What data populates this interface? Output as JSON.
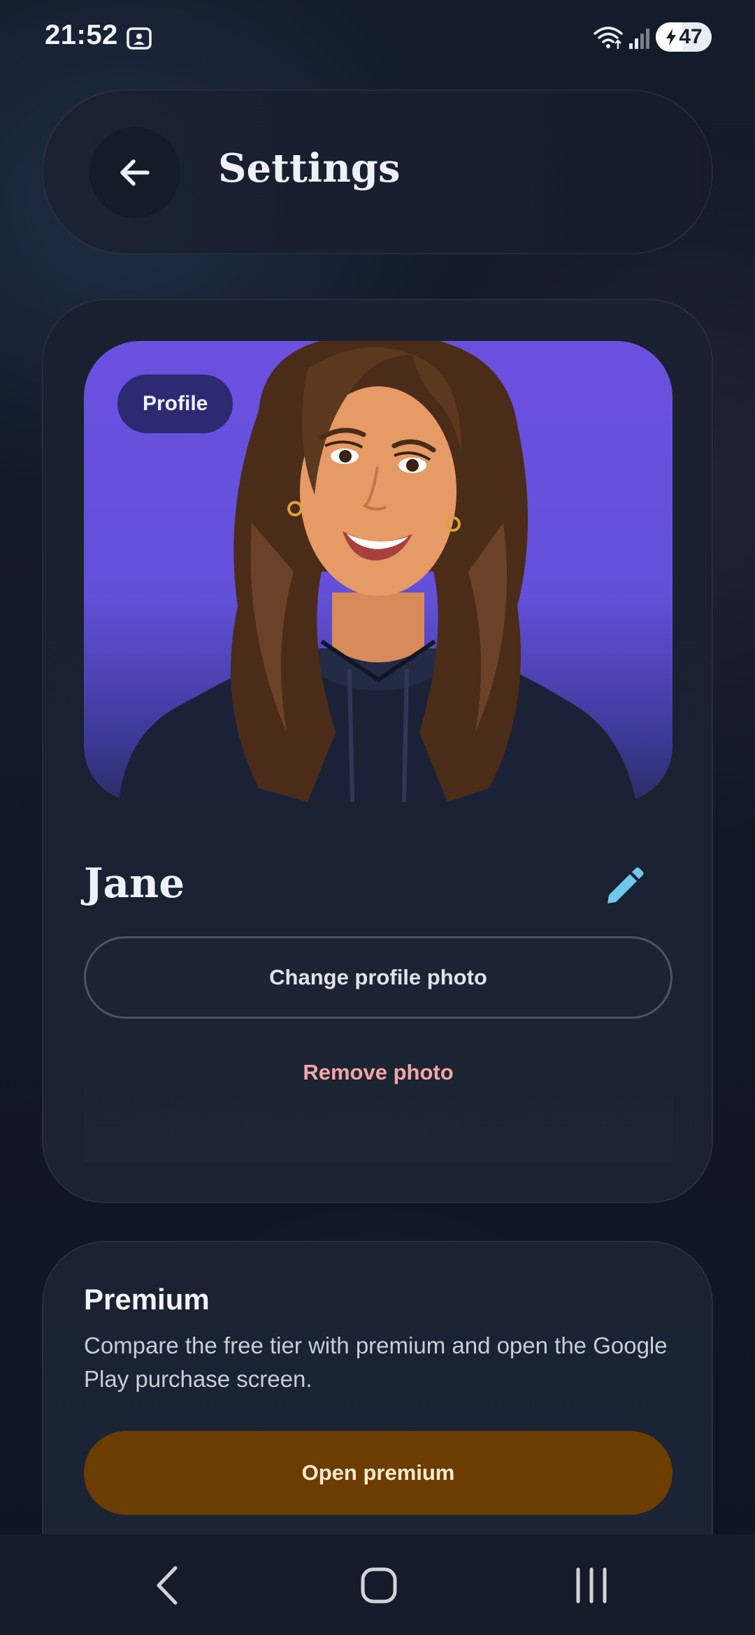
{
  "status_bar": {
    "time": "21:52",
    "battery_level": "47",
    "battery_fraction": 0.47,
    "icons": [
      "screenshot-icon",
      "wifi-icon",
      "signal-icon",
      "battery-charging-icon"
    ]
  },
  "header": {
    "title": "Settings",
    "back_icon": "arrow-left-icon"
  },
  "profile": {
    "chip_label": "Profile",
    "name": "Jane",
    "edit_icon": "pencil-icon",
    "change_photo_label": "Change profile photo",
    "remove_photo_label": "Remove photo"
  },
  "premium": {
    "title": "Premium",
    "description": "Compare the free tier with premium and open the Google Play purchase screen.",
    "button_label": "Open premium"
  },
  "nav": {
    "icons": [
      "nav-back-icon",
      "nav-home-icon",
      "nav-recents-icon"
    ]
  },
  "colors": {
    "background": "#111827",
    "card": "#19202f",
    "accent_blue": "#6fc8ea",
    "danger_text": "#f2a8a2",
    "premium_button": "#6b3d00",
    "avatar_background": "#6b50e0"
  }
}
